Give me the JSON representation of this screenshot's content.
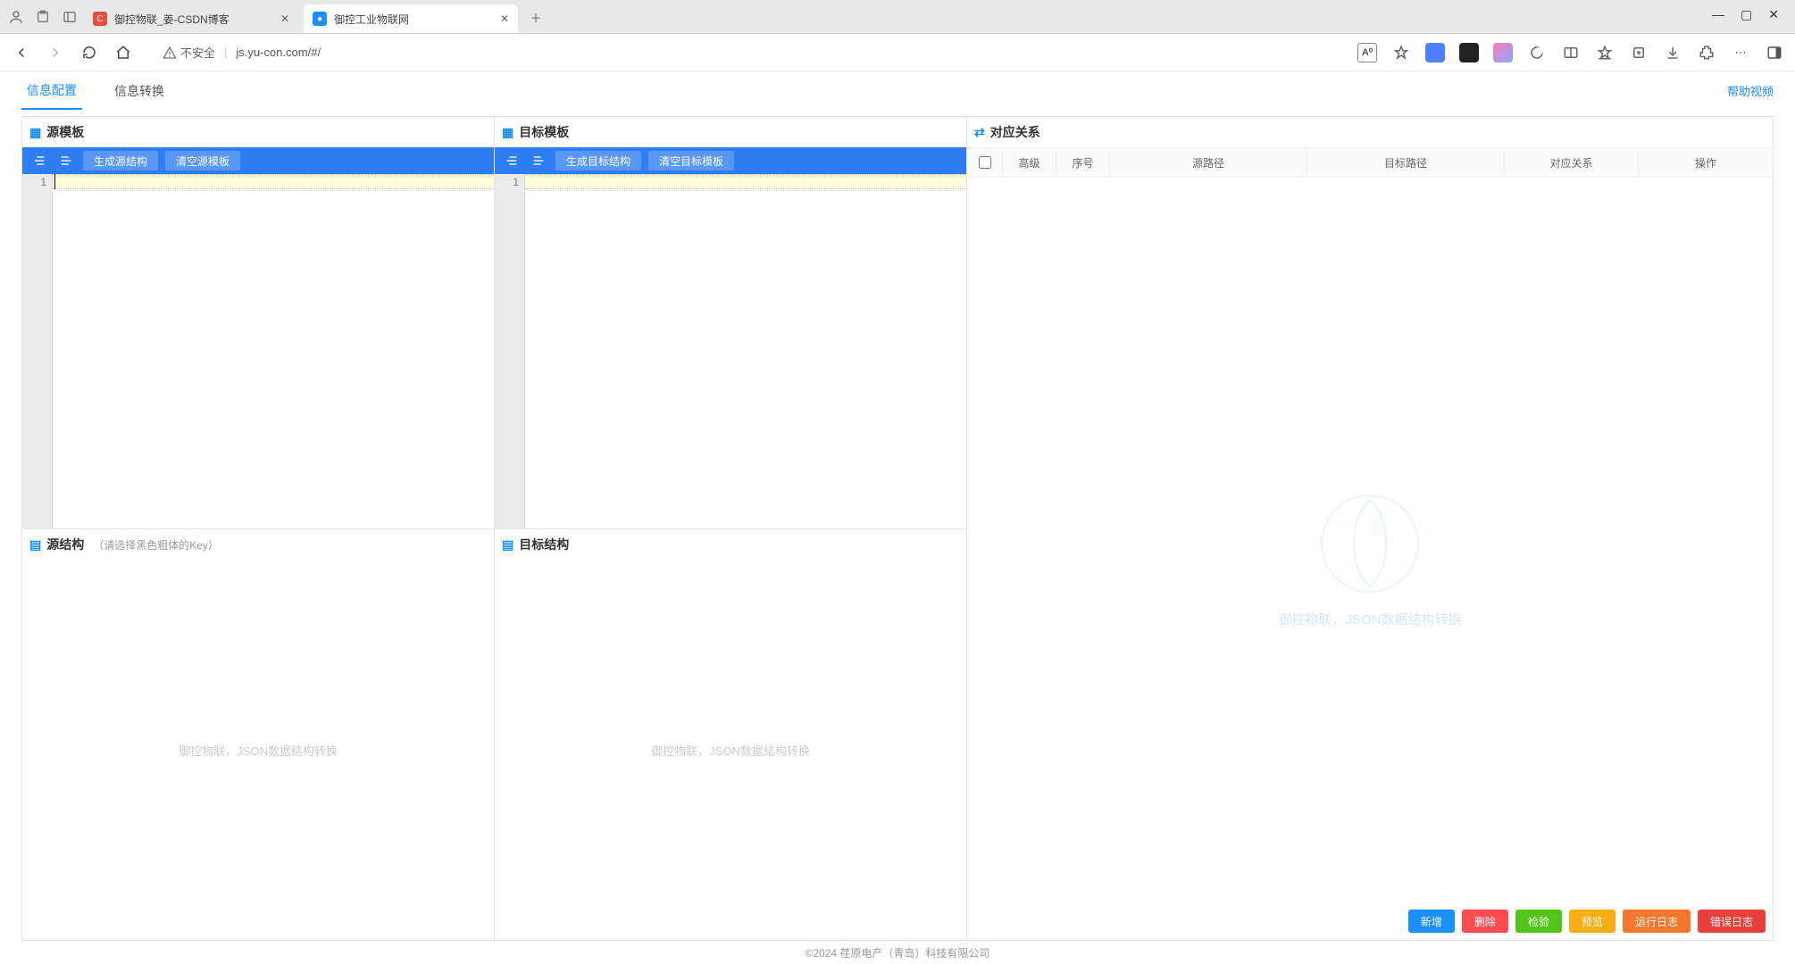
{
  "browser": {
    "tabs": [
      {
        "title": "御控物联_姜-CSDN博客",
        "favicon_bg": "#e74c3c",
        "favicon_txt": "C"
      },
      {
        "title": "御控工业物联网",
        "favicon_bg": "#1890ff",
        "favicon_txt": "●"
      }
    ],
    "active_tab_index": 1,
    "address": {
      "insecure_label": "不安全",
      "url": "js.yu-con.com/#/"
    }
  },
  "page": {
    "tabs": {
      "config": "信息配置",
      "convert": "信息转换"
    },
    "help_link": "帮助视频",
    "source_template": {
      "title": "源模板",
      "toolbar": {
        "gen": "生成源结构",
        "clear": "清空源模板"
      },
      "gutter_start": "1"
    },
    "target_template": {
      "title": "目标模板",
      "toolbar": {
        "gen": "生成目标结构",
        "clear": "清空目标模板"
      },
      "gutter_start": "1"
    },
    "source_struct": {
      "title": "源结构",
      "hint": "（请选择黑色粗体的Key）",
      "watermark": "御控物联，JSON数据结构转换"
    },
    "target_struct": {
      "title": "目标结构",
      "watermark": "御控物联，JSON数据结构转换"
    },
    "mapping": {
      "title": "对应关系",
      "columns": {
        "premium": "高级",
        "index": "序号",
        "src": "源路径",
        "dst": "目标路径",
        "rel": "对应关系",
        "op": "操作"
      },
      "watermark": "御控物联，JSON数据结构转换",
      "actions": {
        "add": "新增",
        "del": "删除",
        "check": "检验",
        "preview": "预览",
        "runlog": "运行日志",
        "errlog": "错误日志"
      }
    },
    "footer": "©2024 荏原电产（青岛）科技有限公司"
  }
}
